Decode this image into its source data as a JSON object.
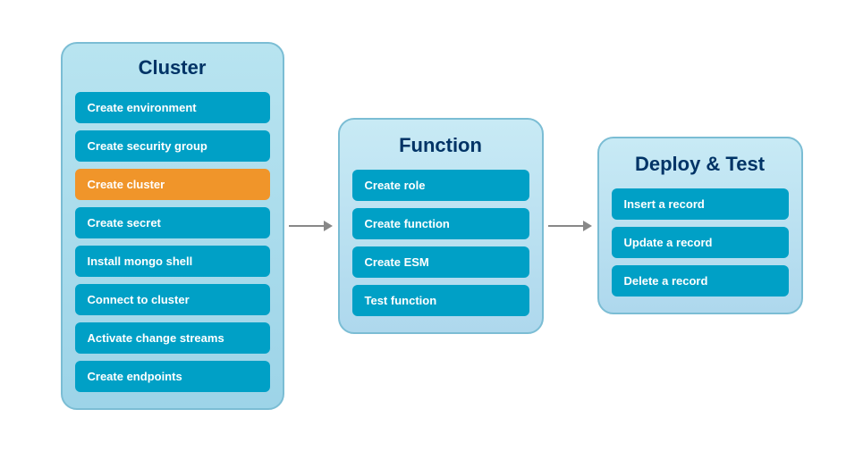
{
  "panels": {
    "cluster": {
      "title": "Cluster",
      "items": [
        {
          "label": "Create environment",
          "active": false
        },
        {
          "label": "Create security group",
          "active": false
        },
        {
          "label": "Create cluster",
          "active": true
        },
        {
          "label": "Create secret",
          "active": false
        },
        {
          "label": "Install mongo shell",
          "active": false
        },
        {
          "label": "Connect to cluster",
          "active": false
        },
        {
          "label": "Activate change streams",
          "active": false
        },
        {
          "label": "Create endpoints",
          "active": false
        }
      ]
    },
    "function": {
      "title": "Function",
      "items": [
        {
          "label": "Create role",
          "active": false
        },
        {
          "label": "Create function",
          "active": false
        },
        {
          "label": "Create ESM",
          "active": false
        },
        {
          "label": "Test function",
          "active": false
        }
      ]
    },
    "deploy": {
      "title": "Deploy & Test",
      "items": [
        {
          "label": "Insert a record",
          "active": false
        },
        {
          "label": "Update a record",
          "active": false
        },
        {
          "label": "Delete a record",
          "active": false
        }
      ]
    }
  }
}
